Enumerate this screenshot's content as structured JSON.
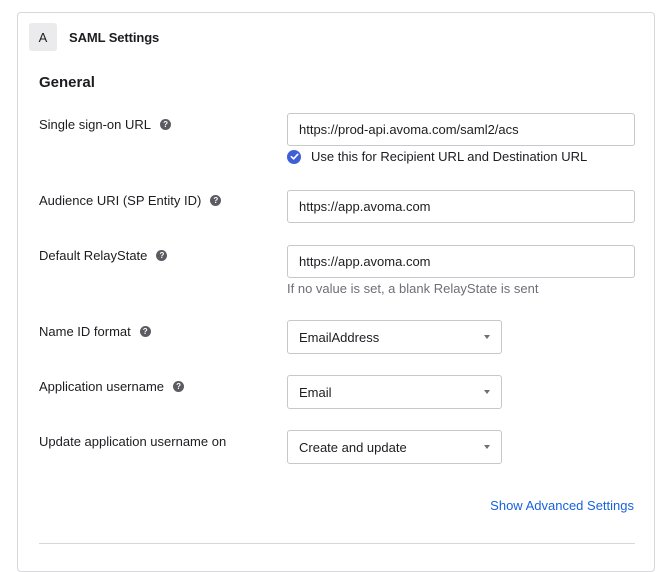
{
  "panel": {
    "step": "A",
    "title": "SAML Settings",
    "section_title": "General"
  },
  "fields": {
    "sso_url": {
      "label": "Single sign-on URL",
      "value": "https://prod-api.avoma.com/saml2/acs"
    },
    "recipient_checkbox": {
      "label": "Use this for Recipient URL and Destination URL",
      "checked": true
    },
    "audience_uri": {
      "label": "Audience URI (SP Entity ID)",
      "value": "https://app.avoma.com"
    },
    "relay_state": {
      "label": "Default RelayState",
      "value": "https://app.avoma.com",
      "hint": "If no value is set, a blank RelayState is sent"
    },
    "name_id_format": {
      "label": "Name ID format",
      "selected": "EmailAddress"
    },
    "app_username": {
      "label": "Application username",
      "selected": "Email"
    },
    "update_username_on": {
      "label": "Update application username on",
      "selected": "Create and update"
    }
  },
  "links": {
    "advanced": "Show Advanced Settings"
  },
  "icons": {
    "help": "help-icon",
    "check": "check-icon",
    "caret": "chevron-down-icon"
  },
  "colors": {
    "accent": "#3f5fd6",
    "link": "#1662dd"
  }
}
